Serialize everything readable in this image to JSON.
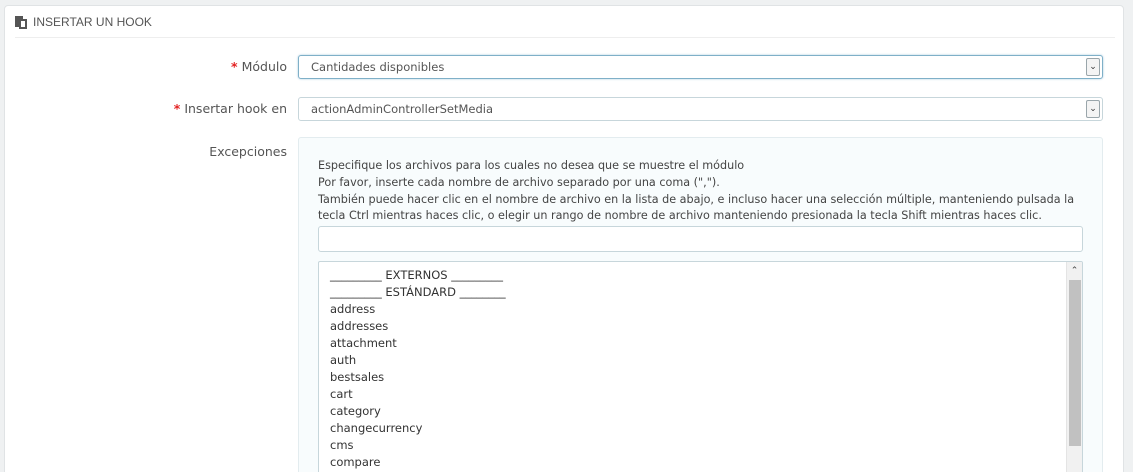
{
  "panel": {
    "title": "INSERTAR UN HOOK",
    "icon": "copy-icon"
  },
  "form": {
    "required_mark": "*",
    "module": {
      "label": "Módulo",
      "value": "Cantidades disponibles"
    },
    "hook": {
      "label": "Insertar hook en",
      "value": "actionAdminControllerSetMedia"
    },
    "exceptions": {
      "label": "Excepciones",
      "help": [
        "Especifique los archivos para los cuales no desea que se muestre el módulo",
        "Por favor, inserte cada nombre de archivo separado por una coma (\",\").",
        "También puede hacer clic en el nombre de archivo en la lista de abajo, e incluso hacer una selección múltiple, manteniendo pulsada la tecla Ctrl mientras haces clic, o elegir un rango de nombre de archivo manteniendo presionada la tecla Shift mientras haces clic."
      ],
      "input_value": "",
      "list": [
        "_________ EXTERNOS _________",
        "_________ ESTÁNDARD ________",
        "address",
        "addresses",
        "attachment",
        "auth",
        "bestsales",
        "cart",
        "category",
        "changecurrency",
        "cms",
        "compare"
      ]
    }
  },
  "colors": {
    "required": "#e32222",
    "accent_border": "#7fb0c8",
    "scroll_thumb": "#c1c1c1"
  }
}
